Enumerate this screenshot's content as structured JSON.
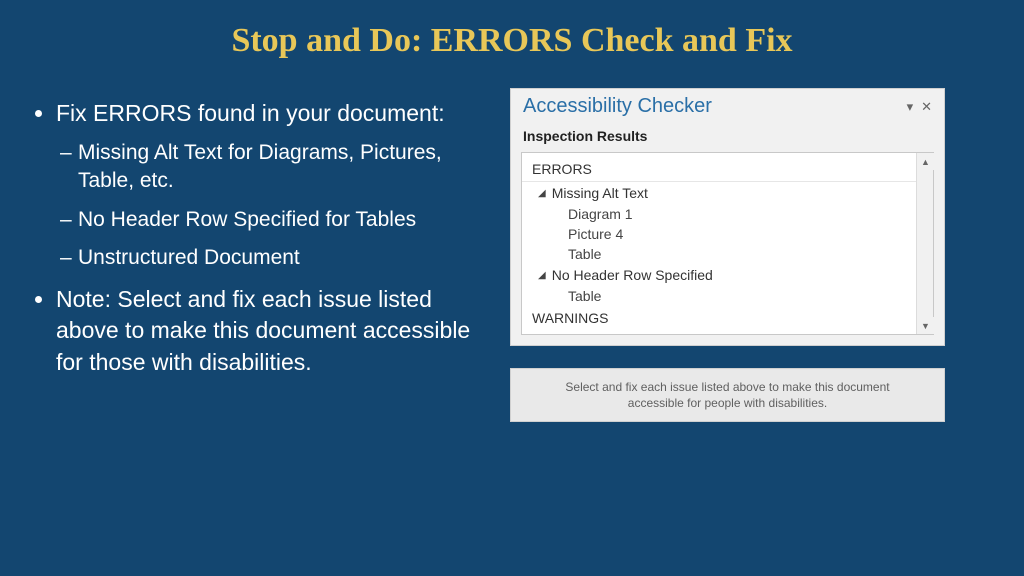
{
  "slide": {
    "title": "Stop and Do: ERRORS Check and Fix",
    "bullets": {
      "b0": {
        "text": "Fix ERRORS found in your document:",
        "sub": {
          "s0": "Missing Alt Text for Diagrams, Pictures, Table, etc.",
          "s1": "No Header Row Specified for Tables",
          "s2": "Unstructured Document"
        }
      },
      "b1": {
        "text": "Note: Select and fix each issue listed above to make this document accessible for those with disabilities."
      }
    }
  },
  "panel": {
    "title": "Accessibility Checker",
    "dropdown_glyph": "▾",
    "close_glyph": "✕",
    "sub": "Inspection Results",
    "sections": {
      "errors_label": "ERRORS",
      "warnings_label": "WARNINGS",
      "group0": {
        "label": "Missing Alt Text",
        "items": {
          "i0": "Diagram 1",
          "i1": "Picture 4",
          "i2": "Table"
        }
      },
      "group1": {
        "label": "No Header Row Specified",
        "items": {
          "i0": "Table"
        }
      }
    },
    "scroll": {
      "up": "▲",
      "down": "▼"
    }
  },
  "hint": {
    "text": "Select and fix each issue listed above to make this document accessible for people with disabilities."
  }
}
